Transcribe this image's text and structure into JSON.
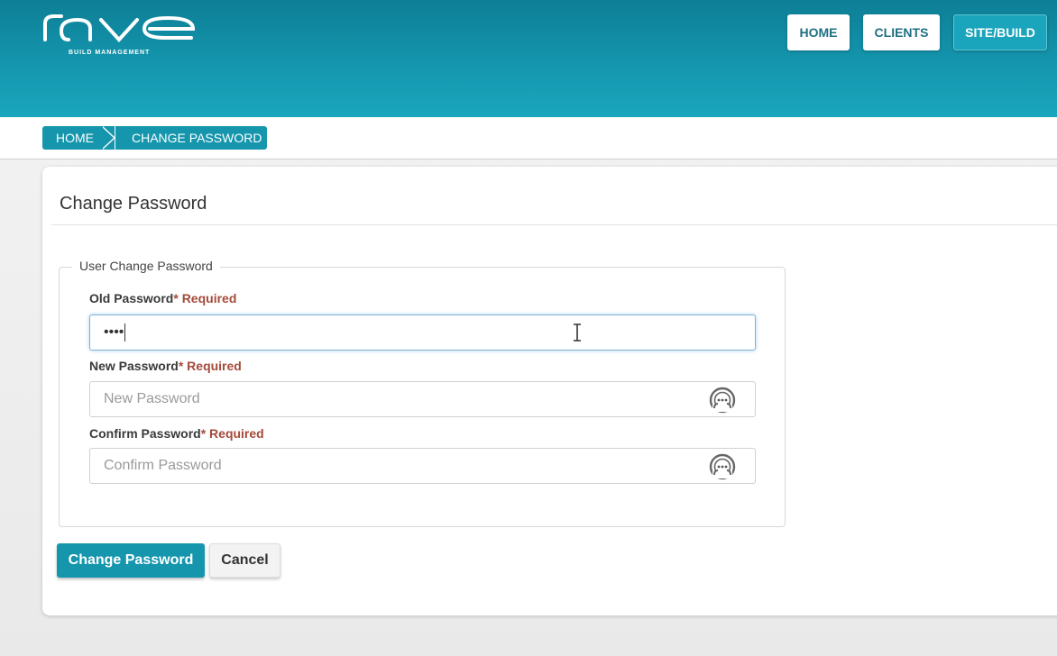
{
  "header": {
    "logo_text": "rave",
    "logo_subtitle": "BUILD MANAGEMENT",
    "nav": {
      "home": "HOME",
      "clients": "CLIENTS",
      "site_build": "SITE/BUILD"
    }
  },
  "breadcrumb": {
    "home": "HOME",
    "current": "CHANGE PASSWORD"
  },
  "card": {
    "title": "Change Password",
    "fieldset_legend": "User Change Password",
    "fields": {
      "old": {
        "label": "Old Password",
        "required": "* Required",
        "value": "••••"
      },
      "new": {
        "label": "New Password",
        "required": "* Required",
        "placeholder": "New Password"
      },
      "confirm": {
        "label": "Confirm Password",
        "required": "* Required",
        "placeholder": "Confirm Password"
      }
    },
    "buttons": {
      "submit": "Change Password",
      "cancel": "Cancel"
    }
  },
  "colors": {
    "header_top": "#0d7f96",
    "accent": "#1596ad",
    "required": "#a54a3a"
  },
  "icons": {
    "reveal_password": "eye-dots-icon",
    "text_cursor": "ibeam-cursor-icon"
  }
}
